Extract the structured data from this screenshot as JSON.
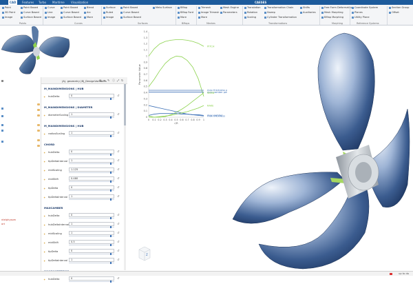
{
  "tabs": [
    {
      "label": "CAD",
      "active": true
    },
    {
      "label": "Features",
      "active": false
    },
    {
      "label": "Turbo",
      "active": false
    },
    {
      "label": "Maritime",
      "active": false
    },
    {
      "label": "Visualization",
      "active": false
    }
  ],
  "context_label": "CAESES",
  "ribbon": {
    "points": [
      "Point",
      "3D Point",
      "Image"
    ],
    "pointsFull": [
      "Point Based",
      "Curve Based",
      "Surface Based"
    ],
    "points_group": "Points",
    "curves": [
      "Curve",
      "Line",
      "Image"
    ],
    "curvesFull": [
      "Point Based",
      "Curve Based",
      "Surface Based"
    ],
    "curves_group": "Curves",
    "misc": [
      "Blend",
      "Arc",
      "More"
    ],
    "surfaces": [
      "Surface",
      "Ruled",
      "Image"
    ],
    "surfacesFull": [
      "Point Based",
      "Curve Based",
      "Surface Based"
    ],
    "meta": "Meta Surface",
    "surfaces_group": "Surfaces",
    "bmaps": [
      "BMap",
      "BMap Ford",
      "More"
    ],
    "bmaps_group": "BMaps",
    "meshes": [
      "Trimesh",
      "Image Trimesh",
      "More"
    ],
    "meshes_group": "Meshes",
    "mesh_engine": [
      "Mesh Engine",
      "Parameters"
    ],
    "transforms": [
      "Translation",
      "Rotation",
      "Scaling"
    ],
    "transforms2": [
      "Transformation Chain",
      "Sweep",
      "Cylinder Transformation"
    ],
    "transforms_group": "Transformations",
    "shifts": [
      "Shifts",
      "Auxiliaries"
    ],
    "morph": [
      "Free Form Deformation",
      "Mesh Morphing",
      "BMap Morphing"
    ],
    "morph_group": "Morphing",
    "ref": [
      "Coordinate System",
      "Planes",
      "Utility Plane"
    ],
    "ref_group": "Reference Systems",
    "sections": [
      "Section Group",
      "Offset"
    ]
  },
  "panel": {
    "title": "|A|. geometry |B|_DesignVariables",
    "sections": [
      {
        "title": "M_MAINDIMENSIONS | HUB",
        "rows": [
          {
            "label": "hubDelta",
            "value": "0"
          }
        ]
      },
      {
        "title": "M_MAINDIMENSIONS | DIAMETER",
        "rows": [
          {
            "label": "diameterScaling",
            "value": "1"
          }
        ]
      },
      {
        "title": "M_MAINDIMENSIONS | HUB",
        "rows": [
          {
            "label": "radiusScaling",
            "value": "1"
          }
        ]
      },
      {
        "title": "CHORD",
        "rows": [
          {
            "label": "hubDelta",
            "value": "0"
          },
          {
            "label": "tipDeltaInterval",
            "value": "1"
          },
          {
            "label": "midScaling",
            "value": "1.125"
          },
          {
            "label": "midShift",
            "value": "0.480"
          },
          {
            "label": "tipDelta",
            "value": "0"
          },
          {
            "label": "tipDeltaInterval",
            "value": "1"
          }
        ]
      },
      {
        "title": "MAXCAMBER",
        "rows": [
          {
            "label": "hubDelta",
            "value": "0"
          },
          {
            "label": "hubDeltaInterval",
            "value": "1"
          },
          {
            "label": "midScaling",
            "value": "1"
          },
          {
            "label": "midShift",
            "value": "0.5"
          },
          {
            "label": "tipDelta",
            "value": "0"
          },
          {
            "label": "tipDeltaInterval",
            "value": "1"
          }
        ]
      },
      {
        "title": "MAXCAMBERPOS",
        "rows": [
          {
            "label": "hubDelta",
            "value": "0"
          }
        ]
      }
    ]
  },
  "tree": {
    "items": [
      "ntelphysom",
      "ort"
    ]
  },
  "chart_data": {
    "type": "line",
    "xlabel": "r/R",
    "ylabel": "Parameter Value",
    "x": [
      0,
      0.1,
      0.2,
      0.3,
      0.4,
      0.5,
      0.6,
      0.7,
      0.8,
      0.9,
      1
    ],
    "xlim": [
      0,
      1
    ],
    "ylim": [
      0,
      1.4
    ],
    "yticks": [
      0,
      0.1,
      0.2,
      0.3,
      0.4,
      0.5,
      0.6,
      0.7,
      0.8,
      0.9,
      1,
      1.1,
      1.2,
      1.3,
      1.4
    ],
    "series": [
      {
        "name": "pitch",
        "color": "#8bd24c",
        "values": [
          1.0,
          1.12,
          1.2,
          1.24,
          1.26,
          1.27,
          1.27,
          1.26,
          1.24,
          1.21,
          1.16
        ]
      },
      {
        "name": "chord",
        "color": "#8bd24c",
        "values": [
          0.5,
          0.62,
          0.76,
          0.88,
          0.96,
          1.0,
          0.99,
          0.93,
          0.82,
          0.63,
          0.34
        ]
      },
      {
        "name": "max thickness pos",
        "color": "#3b6fb6",
        "values": [
          0.44,
          0.44,
          0.44,
          0.44,
          0.44,
          0.44,
          0.44,
          0.44,
          0.44,
          0.44,
          0.44
        ]
      },
      {
        "name": "max camber pos",
        "color": "#3b6fb6",
        "values": [
          0.41,
          0.41,
          0.41,
          0.41,
          0.41,
          0.41,
          0.41,
          0.41,
          0.41,
          0.41,
          0.41
        ]
      },
      {
        "name": "skew",
        "color": "#8bd24c",
        "values": [
          0.02,
          0.0,
          0.0,
          0.01,
          0.04,
          0.08,
          0.13,
          0.19,
          0.26,
          0.33,
          0.4
        ]
      },
      {
        "name": "max thickness",
        "color": "#3b6fb6",
        "values": [
          0.19,
          0.17,
          0.15,
          0.13,
          0.11,
          0.09,
          0.07,
          0.05,
          0.04,
          0.03,
          0.02
        ]
      },
      {
        "name": "rake",
        "color": "#8bd24c",
        "values": [
          0.0,
          0.0,
          0.01,
          0.02,
          0.03,
          0.05,
          0.07,
          0.09,
          0.12,
          0.15,
          0.19
        ]
      },
      {
        "name": "max camber",
        "color": "#3b6fb6",
        "values": [
          0.03,
          0.05,
          0.06,
          0.06,
          0.06,
          0.06,
          0.05,
          0.05,
          0.04,
          0.04,
          0.03
        ]
      }
    ],
    "labels": [
      {
        "text": "PITCH",
        "series": 0,
        "at": 1
      },
      {
        "text": "CHORD",
        "series": 1,
        "at": 0.55
      },
      {
        "text": "max thickness pos",
        "series": 2,
        "at": 1
      },
      {
        "text": "max camber pos",
        "series": 3,
        "at": 1
      },
      {
        "text": "SKEW",
        "series": 4,
        "at": 1
      },
      {
        "text": "max thickness",
        "series": 5,
        "at": 1
      },
      {
        "text": "RAKE",
        "series": 6,
        "at": 1
      },
      {
        "text": "max camber",
        "series": 7,
        "at": 1
      }
    ]
  },
  "cube": {
    "label": "Z"
  },
  "status": {
    "text": "up to da"
  }
}
